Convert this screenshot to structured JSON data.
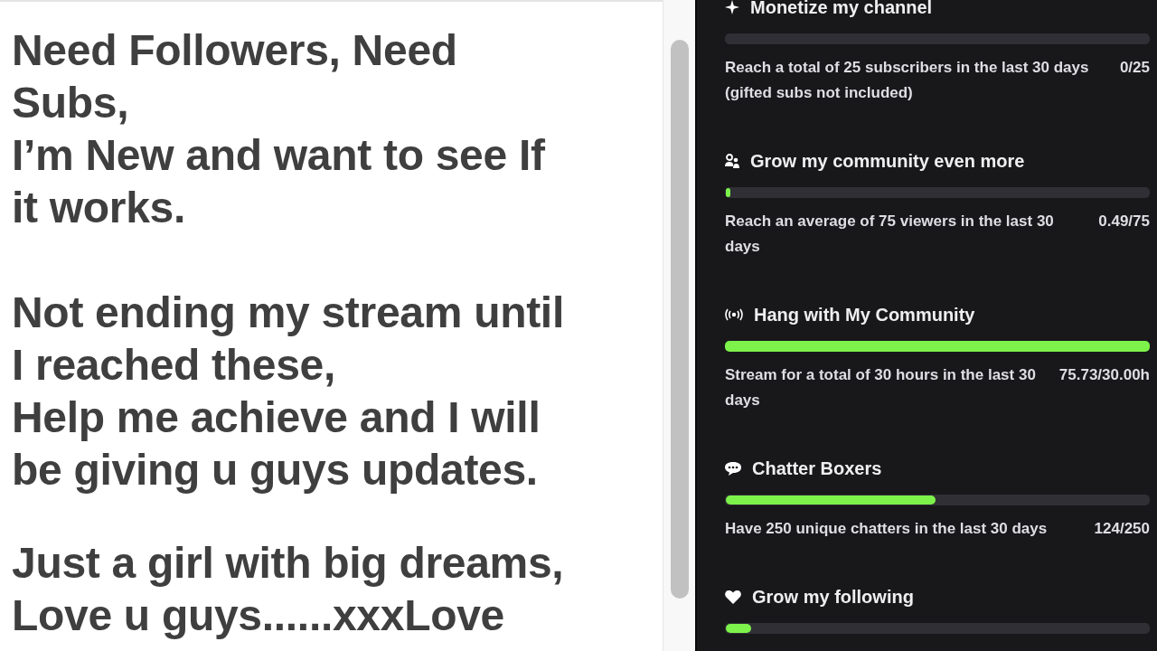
{
  "notes": [
    {
      "lines": [
        "Need Followers, Need",
        "Subs,",
        "I’m New and want to see If",
        "it works."
      ]
    },
    {
      "lines": [
        "Not ending my stream until",
        "I reached these,",
        "Help me achieve and I will",
        "be giving u guys updates."
      ]
    },
    {
      "lines": [
        "Just a girl with big dreams,",
        "Love u guys......xxxLove"
      ]
    }
  ],
  "goals": [
    {
      "kind": "sparkle",
      "title": "Monetize my channel",
      "description": "Reach a total of 25 subscribers in the last 30 days (gifted subs not included)",
      "progress": "0/25"
    },
    {
      "kind": "people",
      "title": "Grow my community even more",
      "level": 0.01,
      "description": "Reach an average of 75 viewers in the last 30 days",
      "progress": "0.49/75"
    },
    {
      "kind": "broadcast",
      "title": "Hang with My Community",
      "complete": true,
      "description": "Stream for a total of 30 hours in the last 30 days",
      "progress": "75.73/30.00h"
    },
    {
      "kind": "chat",
      "title": "Chatter Boxers",
      "level": 0.496,
      "description": "Have 250 unique chatters in the last 30 days",
      "progress": "124/250"
    },
    {
      "kind": "heart",
      "title": "Grow my following",
      "level": 0.06
    }
  ]
}
